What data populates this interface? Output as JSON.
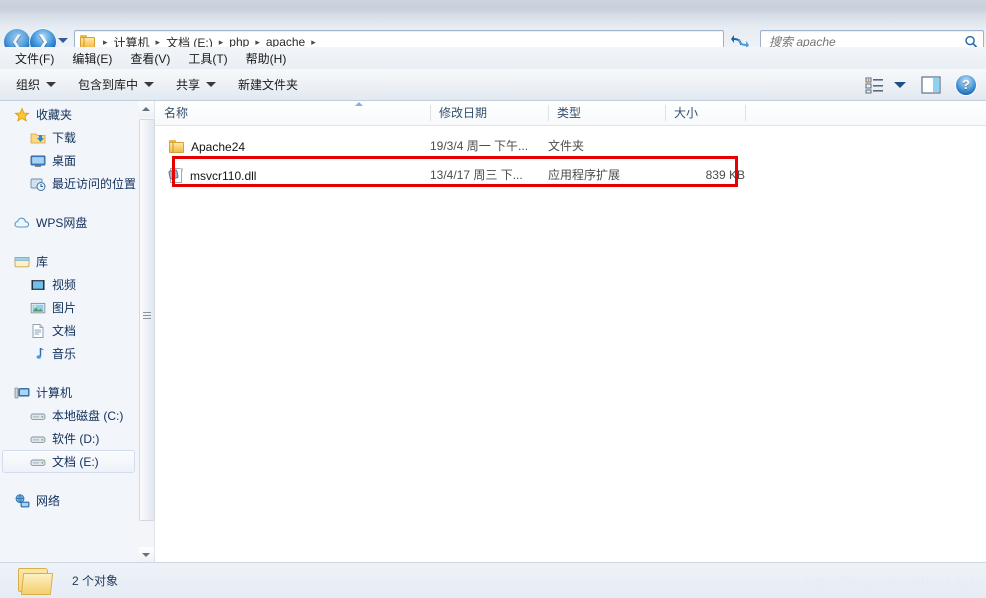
{
  "window": {
    "status_text": "2 个对象",
    "watermark": "https://blog.csdn.net/w_l_k_i"
  },
  "address_bar": {
    "folder_icon": "folder-icon",
    "back_icon": "back-arrow-icon",
    "forward_icon": "forward-arrow-icon",
    "history_icon": "chevron-down-icon",
    "refresh_icon": "refresh-icon",
    "dropdown_icon": "chevron-down-icon",
    "breadcrumbs": [
      {
        "label": "计算机"
      },
      {
        "label": "文档 (E:)"
      },
      {
        "label": "php"
      },
      {
        "label": "apache"
      }
    ],
    "separator": "▶"
  },
  "search": {
    "placeholder": "搜索 apache",
    "value": "",
    "icon": "search-icon"
  },
  "menubar": {
    "items": [
      {
        "label": "文件(F)"
      },
      {
        "label": "编辑(E)"
      },
      {
        "label": "查看(V)"
      },
      {
        "label": "工具(T)"
      },
      {
        "label": "帮助(H)"
      }
    ]
  },
  "toolbar": {
    "items": [
      {
        "label": "组织",
        "has_caret": true
      },
      {
        "label": "包含到库中",
        "has_caret": true
      },
      {
        "label": "共享",
        "has_caret": true
      },
      {
        "label": "新建文件夹",
        "has_caret": false
      }
    ],
    "view_icon": "view-options-icon",
    "view_caret_icon": "chevron-down-icon",
    "preview_pane_icon": "preview-pane-icon",
    "help_icon": "help-icon",
    "help_label": "?"
  },
  "sidebar": {
    "groups": [
      {
        "header": {
          "label": "收藏夹",
          "icon": "star-icon"
        },
        "items": [
          {
            "label": "下载",
            "icon": "download-folder-icon",
            "selected": false
          },
          {
            "label": "桌面",
            "icon": "desktop-icon",
            "selected": false
          },
          {
            "label": "最近访问的位置",
            "icon": "recent-places-icon",
            "selected": false
          }
        ]
      },
      {
        "header": {
          "label": "WPS网盘",
          "icon": "cloud-icon"
        },
        "items": []
      },
      {
        "header": {
          "label": "库",
          "icon": "library-icon"
        },
        "items": [
          {
            "label": "视频",
            "icon": "video-icon",
            "selected": false
          },
          {
            "label": "图片",
            "icon": "picture-icon",
            "selected": false
          },
          {
            "label": "文档",
            "icon": "document-icon",
            "selected": false
          },
          {
            "label": "音乐",
            "icon": "music-icon",
            "selected": false
          }
        ]
      },
      {
        "header": {
          "label": "计算机",
          "icon": "computer-icon"
        },
        "items": [
          {
            "label": "本地磁盘 (C:)",
            "icon": "drive-icon",
            "selected": false
          },
          {
            "label": "软件 (D:)",
            "icon": "drive-icon",
            "selected": false
          },
          {
            "label": "文档 (E:)",
            "icon": "drive-icon",
            "selected": true
          }
        ]
      },
      {
        "header": {
          "label": "网络",
          "icon": "network-icon"
        },
        "items": []
      }
    ],
    "scroll_up_icon": "scroll-up-arrow-icon",
    "scroll_down_icon": "scroll-down-arrow-icon"
  },
  "file_list": {
    "columns": [
      {
        "label": "名称",
        "sorted": true
      },
      {
        "label": "修改日期",
        "sorted": false
      },
      {
        "label": "类型",
        "sorted": false
      },
      {
        "label": "大小",
        "sorted": false
      }
    ],
    "rows": [
      {
        "name": "Apache24",
        "date": "19/3/4 周一 下午...",
        "type": "文件夹",
        "size": "",
        "icon": "folder-icon",
        "highlighted": false
      },
      {
        "name": "msvcr110.dll",
        "date": "13/4/17 周三 下...",
        "type": "应用程序扩展",
        "size": "839 KB",
        "icon": "dll-file-icon",
        "highlighted": true
      }
    ]
  },
  "annotation": {
    "color": "#e60000",
    "target_row": "msvcr110.dll"
  }
}
